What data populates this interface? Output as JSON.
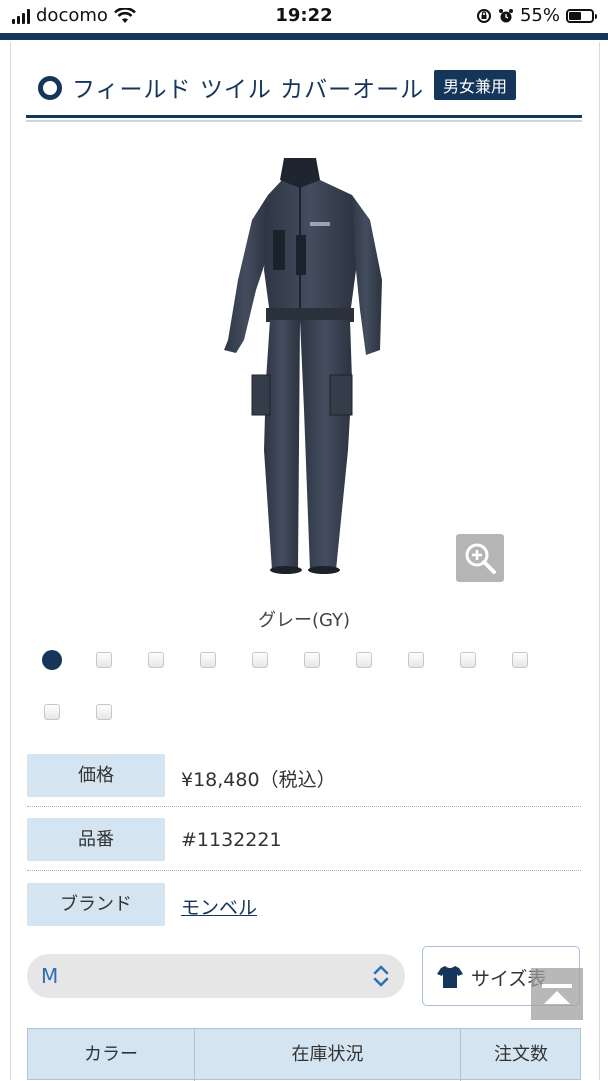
{
  "status_bar": {
    "carrier": "docomo",
    "time": "19:22",
    "battery_percent": "55%",
    "battery_level": 0.55
  },
  "product": {
    "title": "フィールド ツイル カバーオール",
    "badge": "男女兼用",
    "color_name": "グレー(GY)",
    "swatch_count": 12,
    "selected_swatch": 0
  },
  "specs": {
    "price_label": "価格",
    "price_value": "¥18,480（税込）",
    "sku_label": "品番",
    "sku_value": "#1132221",
    "brand_label": "ブランド",
    "brand_value": "モンベル"
  },
  "size": {
    "selected": "M",
    "size_table_label": "サイズ表"
  },
  "stock_table": {
    "headers": [
      "カラー",
      "在庫状況",
      "注文数"
    ]
  },
  "colors": {
    "navy": "#15355a",
    "label_bg": "#d5e4f1",
    "select_text": "#2a6fb8"
  },
  "icons": [
    "signal-icon",
    "wifi-icon",
    "rotation-lock-icon",
    "alarm-icon",
    "battery-icon",
    "zoom-in-icon",
    "chevron-updown-icon",
    "tshirt-icon",
    "arrow-up-icon"
  ]
}
